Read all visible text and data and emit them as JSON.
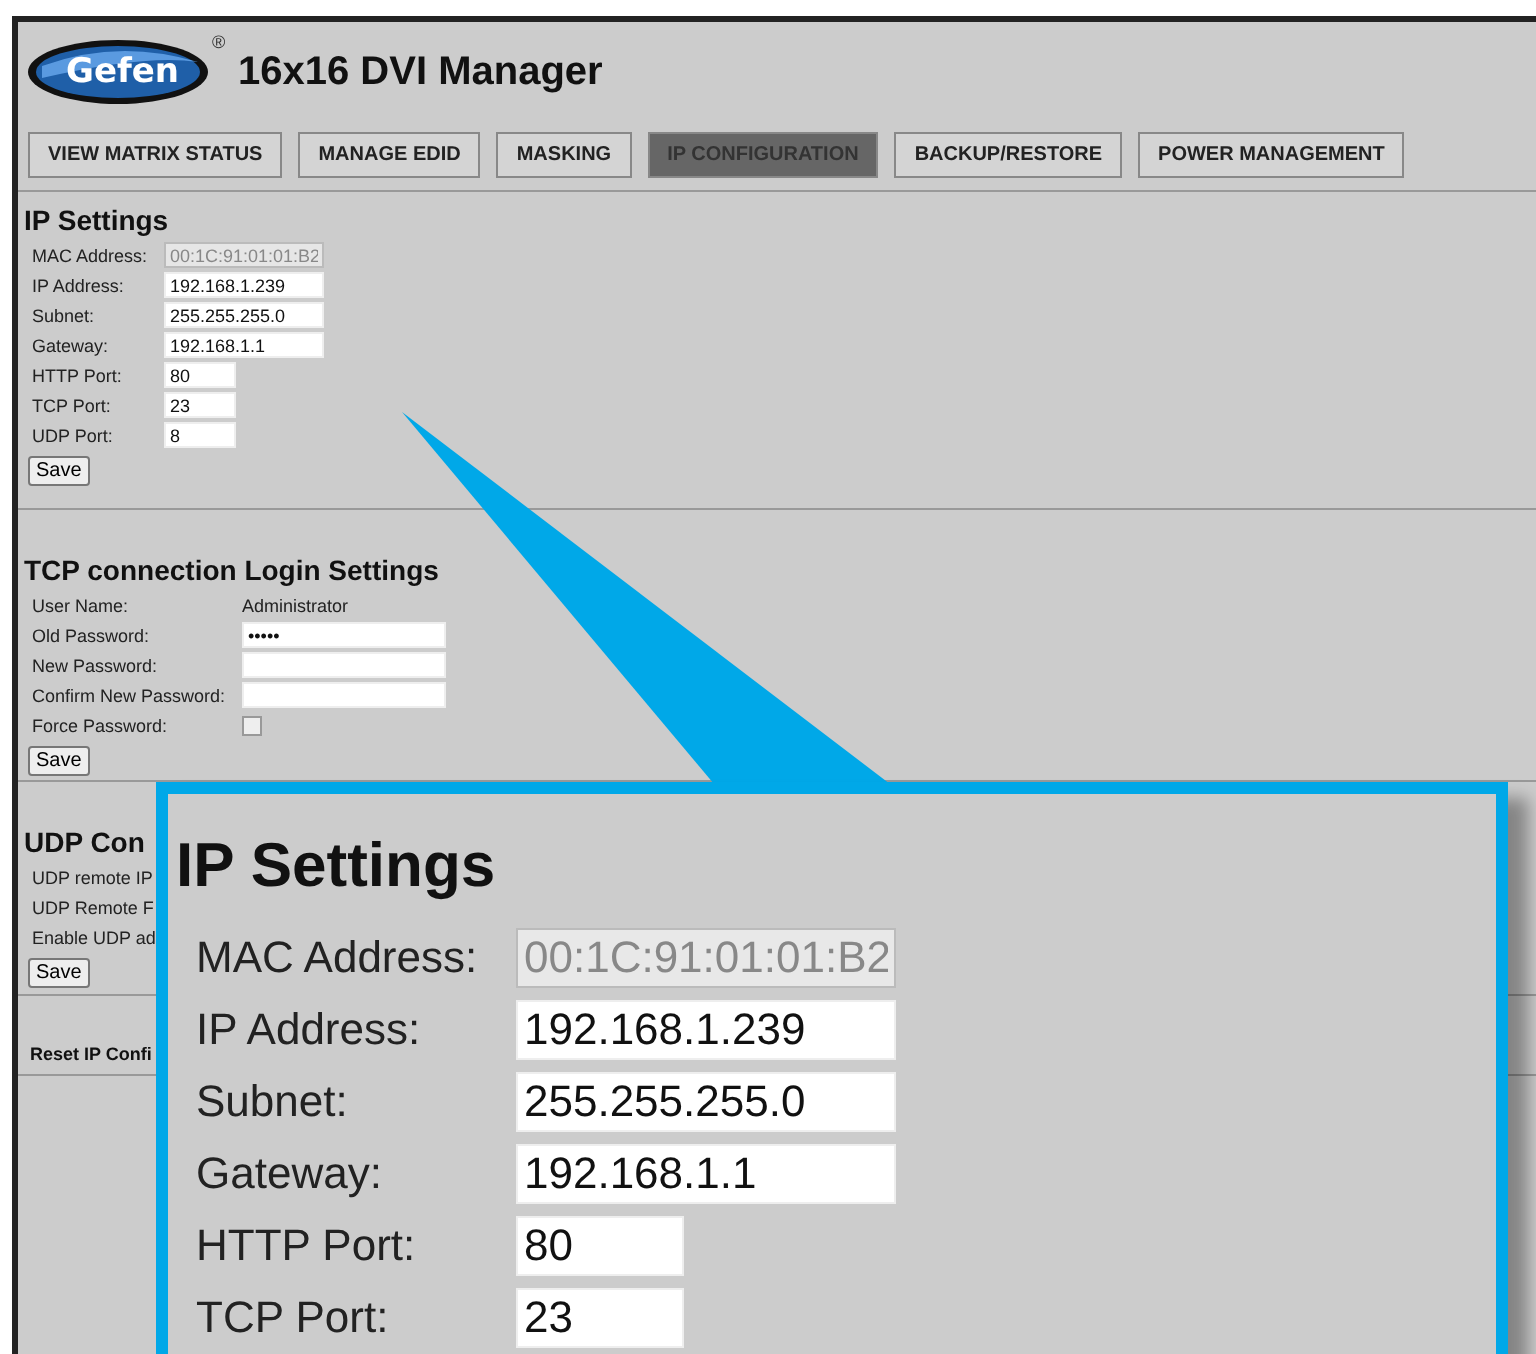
{
  "header": {
    "logo": "Gefen",
    "logo_mark": "®",
    "title": "16x16 DVI Manager"
  },
  "nav": [
    {
      "label": "VIEW MATRIX STATUS",
      "selected": false
    },
    {
      "label": "MANAGE EDID",
      "selected": false
    },
    {
      "label": "MASKING",
      "selected": false
    },
    {
      "label": "IP CONFIGURATION",
      "selected": true
    },
    {
      "label": "BACKUP/RESTORE",
      "selected": false
    },
    {
      "label": "POWER MANAGEMENT",
      "selected": false
    }
  ],
  "ip_settings": {
    "title": "IP Settings",
    "fields": [
      {
        "label": "MAC Address:",
        "value": "00:1C:91:01:01:B2",
        "disabled": true,
        "kind": "address"
      },
      {
        "label": "IP Address:",
        "value": "192.168.1.239",
        "disabled": false,
        "kind": "address"
      },
      {
        "label": "Subnet:",
        "value": "255.255.255.0",
        "disabled": false,
        "kind": "address"
      },
      {
        "label": "Gateway:",
        "value": "192.168.1.1",
        "disabled": false,
        "kind": "address"
      },
      {
        "label": "HTTP Port:",
        "value": "80",
        "disabled": false,
        "kind": "port"
      },
      {
        "label": "TCP Port:",
        "value": "23",
        "disabled": false,
        "kind": "port"
      },
      {
        "label": "UDP Port:",
        "value": "8",
        "disabled": false,
        "kind": "port"
      }
    ],
    "save": "Save"
  },
  "tcp_login": {
    "title": "TCP connection Login Settings",
    "rows": [
      {
        "kind": "text",
        "label": "User Name:",
        "value": "Administrator"
      },
      {
        "kind": "input",
        "label": "Old Password:",
        "value": "•••••"
      },
      {
        "kind": "input",
        "label": "New Password:"
      },
      {
        "kind": "input",
        "label": "Confirm New Password:"
      },
      {
        "kind": "checkbox",
        "label": "Force Password:",
        "checked": false
      }
    ],
    "save": "Save"
  },
  "udp": {
    "title": "UDP Con",
    "rows": [
      "UDP remote IP",
      "UDP Remote F",
      "Enable UDP ad"
    ],
    "save": "Save"
  },
  "reset": {
    "label": "Reset IP Confi"
  },
  "callout": {
    "title": "IP Settings",
    "fields": [
      {
        "label": "MAC Address:",
        "value": "00:1C:91:01:01:B2",
        "disabled": true,
        "kind": "address"
      },
      {
        "label": "IP Address:",
        "value": "192.168.1.239",
        "disabled": false,
        "kind": "address"
      },
      {
        "label": "Subnet:",
        "value": "255.255.255.0",
        "disabled": false,
        "kind": "address"
      },
      {
        "label": "Gateway:",
        "value": "192.168.1.1",
        "disabled": false,
        "kind": "address"
      },
      {
        "label": "HTTP Port:",
        "value": "80",
        "disabled": false,
        "kind": "port"
      },
      {
        "label": "TCP Port:",
        "value": "23",
        "disabled": false,
        "kind": "port"
      }
    ]
  }
}
